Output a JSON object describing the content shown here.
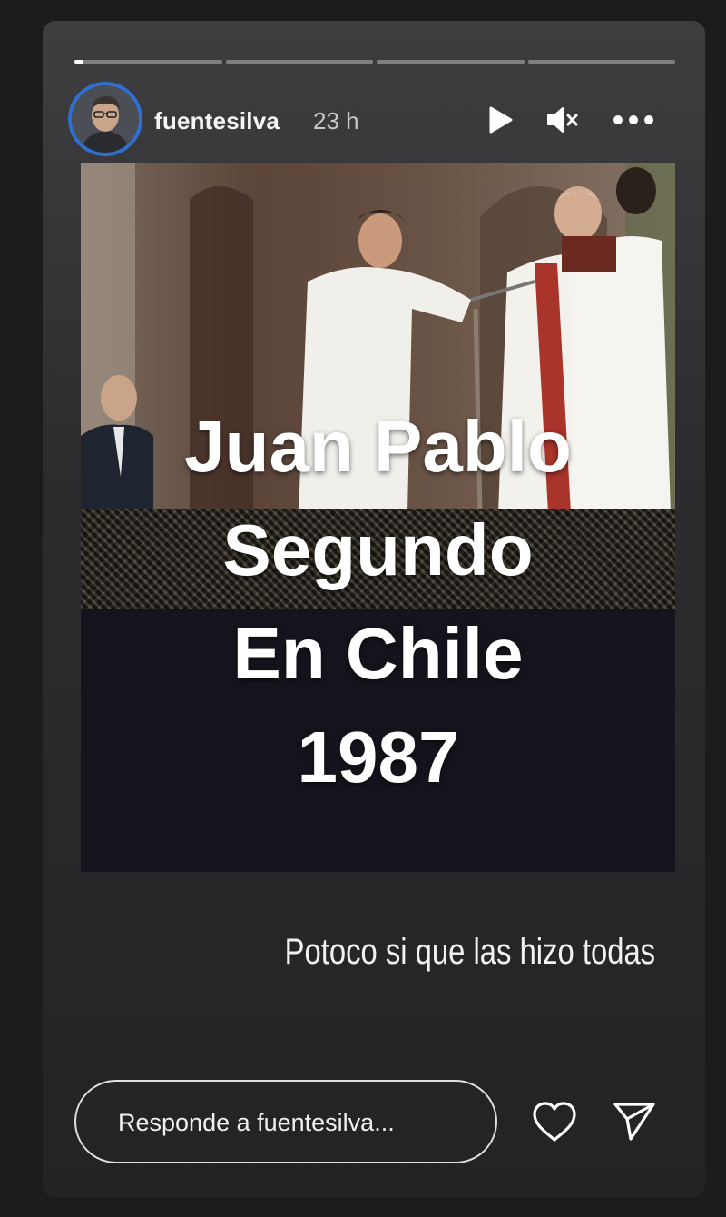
{
  "story": {
    "segments": [
      {
        "progress": 0.06
      },
      {
        "progress": 0
      },
      {
        "progress": 0
      },
      {
        "progress": 0
      }
    ],
    "user": {
      "username": "fuentesilva",
      "time": "23 h"
    },
    "controls": {
      "play_icon": "play-icon",
      "mute_icon": "speaker-muted-icon",
      "more_icon": "more-options-icon"
    },
    "media": {
      "lines": [
        "Juan Pablo",
        "Segundo",
        "En Chile",
        "1987"
      ]
    },
    "caption": "Potoco si que las hizo todas"
  },
  "reply": {
    "placeholder": "Responde a fuentesilva..."
  },
  "actions": {
    "like_icon": "heart-icon",
    "share_icon": "send-icon"
  },
  "colors": {
    "avatar_ring": "#2e6fd0",
    "background": "#1c1c1d"
  }
}
